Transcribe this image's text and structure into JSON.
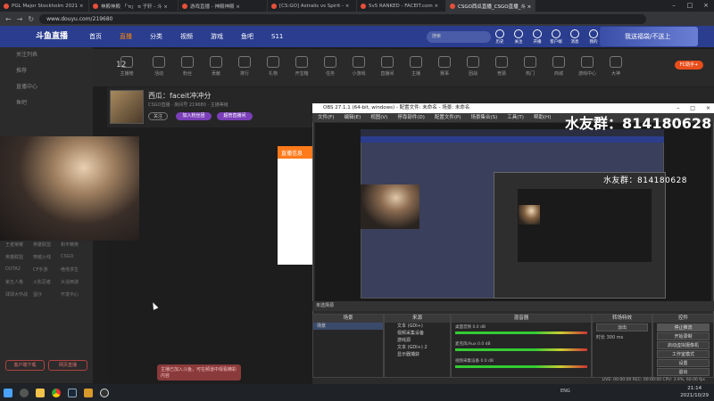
{
  "browser": {
    "tabs": [
      {
        "label": "PGL Major Stockholm 2021 ×",
        "active": false
      },
      {
        "label": "神殿神殿 「'ʊ」 ʊ 子轩 - 斗 ×",
        "active": false
      },
      {
        "label": "游戏直播 - 神殿神殿 ×",
        "active": false
      },
      {
        "label": "[CS:GO] Astralis vs Spirit - ×",
        "active": false
      },
      {
        "label": "5v5 RANKED - FACEIT.com ×",
        "active": false
      },
      {
        "label": "CSGO西瓜直播_CSGO直播_斗 ×",
        "active": true
      }
    ],
    "url": "www.douyu.com/219680",
    "window_controls": [
      "–",
      "□",
      "×"
    ]
  },
  "douyu": {
    "logo": "斗鱼直播",
    "nav": [
      "首页",
      "直播",
      "分类",
      "视频",
      "游戏",
      "鱼吧",
      "S11"
    ],
    "active_nav": "直播",
    "search_placeholder": "搜索",
    "header_icons": [
      "历史",
      "关注",
      "开播",
      "客户端",
      "消息",
      "我的"
    ],
    "banner_text": "我送福袋/不送上"
  },
  "sidebar": {
    "items": [
      "关注列表",
      "推荐",
      "直播中心",
      "鱼吧"
    ],
    "grid_items": [
      "王者荣耀",
      "英雄联盟",
      "和平精英",
      "英雄联盟",
      "穿越火线",
      "CSGO",
      "DOTA2",
      "CF手游",
      "绝地求生",
      "第五人格",
      "火影忍者",
      "大话西游",
      "球球大作战",
      "蛋仔",
      "开发中心"
    ],
    "bottom_buttons": [
      "客户端下载",
      "网页直播"
    ]
  },
  "categories": [
    "主播榜",
    "活动",
    "粉丝",
    "贡献",
    "排行",
    "礼物",
    "开宝箱",
    "任务",
    "小游戏",
    "直播间",
    "主播",
    "赛事",
    "团战",
    "竞猜",
    "热门",
    "商城",
    "游戏中心",
    "大神"
  ],
  "fc_button": "FC助手+",
  "count_value": "12",
  "room": {
    "title": "西瓜：faceit冲冲分",
    "subtitle": "CSGO直播 · 房间号 219680 · 主播等级",
    "tags": [
      "关注",
      "加入粉丝团",
      "超管直播间"
    ],
    "notice_title": "直播信息",
    "bottom_tip": "主播已加入斗鱼，可在频道中观看精彩内容"
  },
  "obs": {
    "title": "OBS 27.1.1 (64-bit, windows) - 配置文件: 未命名 - 场景: 未命名",
    "menu": [
      "文件(F)",
      "编辑(E)",
      "视图(V)",
      "停靠部件(D)",
      "配置文件(P)",
      "场景集合(S)",
      "工具(T)",
      "帮助(H)"
    ],
    "watermark": "水友群：814180628",
    "scene_label": "未选择源",
    "docks": {
      "scenes": {
        "title": "场景",
        "items": [
          "场景"
        ]
      },
      "sources": {
        "title": "来源",
        "items": [
          "文本 (GDI+)",
          "视频采集设备",
          "游戏源",
          "文本 (GDI+) 2",
          "显示器捕获"
        ]
      },
      "mixer": {
        "title": "混音器",
        "rows": [
          {
            "name": "桌面音频",
            "db": "0.0 dB"
          },
          {
            "name": "麦克风/Aux",
            "db": "0.0 dB"
          },
          {
            "name": "视频采集设备",
            "db": "0.0 dB"
          }
        ]
      },
      "transitions": {
        "title": "转场特效",
        "fade": "淡出",
        "duration_label": "时长",
        "duration": "300 ms"
      },
      "controls": {
        "title": "控件",
        "buttons": [
          "停止推流",
          "开始录制",
          "启动虚拟摄像机",
          "工作室模式",
          "设置",
          "退出"
        ]
      }
    },
    "status": "LIVE: 00:00:00  REC: 00:00:00  CPU: 3.9%, 60.00 fps"
  },
  "taskbar": {
    "time": "21:14",
    "date": "2021/10/29",
    "tray": "ENG",
    "icons": [
      "start",
      "search",
      "file-explorer",
      "chrome",
      "steam",
      "csgo",
      "obs"
    ]
  },
  "colors": {
    "douyu_header": "#2a3d8f",
    "orange": "#ff7a1a",
    "obs_bg": "#2b2b2b"
  }
}
